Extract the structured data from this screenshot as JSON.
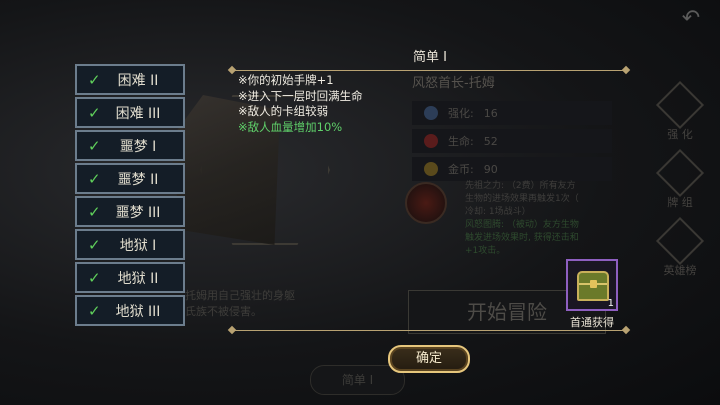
{
  "popup": {
    "title": "简单 I",
    "effects": [
      {
        "text": "※你的初始手牌+1",
        "color": "white"
      },
      {
        "text": "※进入下一层时回满生命",
        "color": "white"
      },
      {
        "text": "※敌人的卡组较弱",
        "color": "white"
      },
      {
        "text": "※敌人血量增加10%",
        "color": "green"
      }
    ],
    "confirm_label": "确定"
  },
  "difficulty_list": [
    {
      "label": "困难 II",
      "checked": true
    },
    {
      "label": "困难 III",
      "checked": true
    },
    {
      "label": "噩梦 I",
      "checked": true
    },
    {
      "label": "噩梦 II",
      "checked": true
    },
    {
      "label": "噩梦 III",
      "checked": true
    },
    {
      "label": "地狱 I",
      "checked": true
    },
    {
      "label": "地狱 II",
      "checked": true
    },
    {
      "label": "地狱 III",
      "checked": true
    }
  ],
  "reward": {
    "count": "1",
    "caption": "首通获得"
  },
  "background": {
    "boss_name": "风怒首长-托姆",
    "stats": [
      {
        "label": "强化:",
        "value": "16"
      },
      {
        "label": "生命:",
        "value": "52"
      },
      {
        "label": "金币:",
        "value": "90"
      }
    ],
    "skill_lines": [
      "先祖之力: （2费）所有友方",
      "生物的进场效果再触发1次（",
      "冷却: 1场战斗）"
    ],
    "skill_lines_green": [
      "风怒图腾: （被动）友方生物",
      "触发进场效果时, 获得还击和",
      "+1攻击。"
    ],
    "side_menu": [
      "强 化",
      "牌 组",
      "英雄榜"
    ],
    "description": [
      "托姆用自己强壮的身躯",
      "氏族不被侵害。"
    ],
    "start_button": "开始冒险",
    "bottom_tab": "简单 I"
  },
  "colors": {
    "check": "#5fcf5b",
    "green_text": "#5fd06a",
    "frame": "#b8a272",
    "reward_border": "#8e5fc0"
  }
}
